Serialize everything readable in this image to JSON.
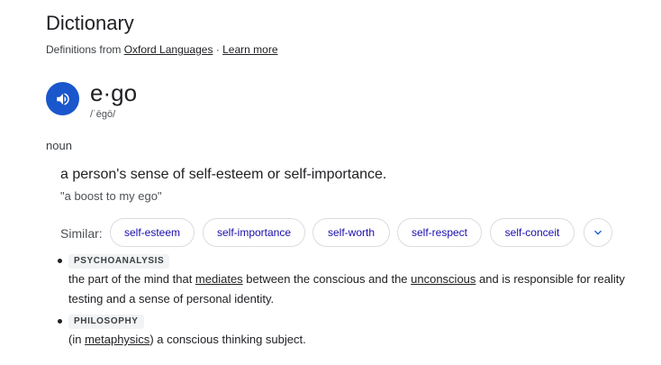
{
  "header": {
    "title": "Dictionary",
    "attribution_prefix": "Definitions from ",
    "source_link": "Oxford Languages",
    "separator": " · ",
    "learn_more": "Learn more"
  },
  "entry": {
    "word": "e·go",
    "phonetic": "/ˈēɡō/",
    "part_of_speech": "noun",
    "speaker_icon": "volume-icon",
    "accent_color": "#1a56cc"
  },
  "sense1": {
    "definition": "a person's sense of self-esteem or self-importance.",
    "example": "\"a boost to my ego\"",
    "similar_label": "Similar:",
    "similar": [
      "self-esteem",
      "self-importance",
      "self-worth",
      "self-respect",
      "self-conceit"
    ],
    "expand_icon": "chevron-down-icon"
  },
  "sense2": {
    "label": "PSYCHOANALYSIS",
    "text_1": "the part of the mind that ",
    "link_1": "mediates",
    "text_2": " between the conscious and the ",
    "link_2": "unconscious",
    "text_3": " and is responsible for reality testing and a sense of personal identity."
  },
  "sense3": {
    "label": "PHILOSOPHY",
    "text_1": "(in ",
    "link_1": "metaphysics",
    "text_2": ") a conscious thinking subject."
  }
}
